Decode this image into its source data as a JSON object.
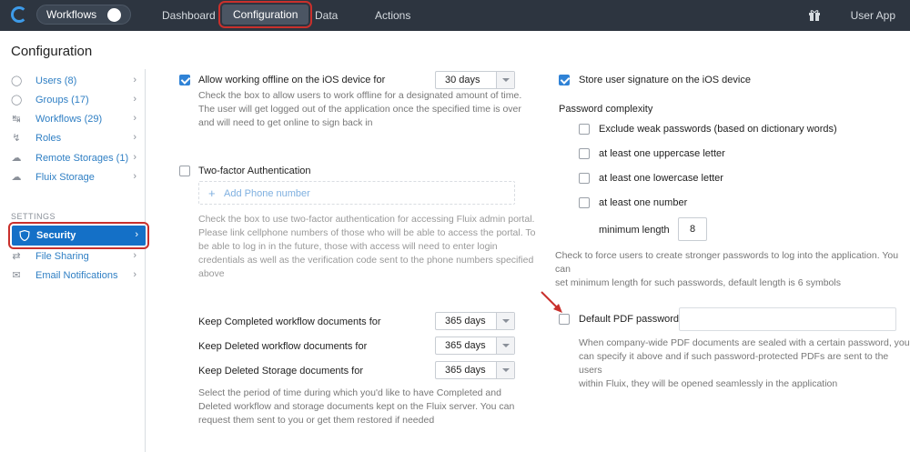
{
  "topbar": {
    "workflows_toggle_label": "Workflows",
    "nav": [
      "Dashboard",
      "Configuration",
      "Data",
      "Actions"
    ],
    "user": "User App"
  },
  "page_title": "Configuration",
  "sidebar": {
    "items": [
      {
        "label": "Users",
        "count": "(8)",
        "icon": "user-icon"
      },
      {
        "label": "Groups",
        "count": "(17)",
        "icon": "group-icon"
      },
      {
        "label": "Workflows",
        "count": "(29)",
        "icon": "workflow-icon"
      },
      {
        "label": "Roles",
        "count": "",
        "icon": "lightning-icon"
      },
      {
        "label": "Remote Storages",
        "count": "(1)",
        "icon": "cloud-icon"
      },
      {
        "label": "Fluix Storage",
        "count": "",
        "icon": "cloud-icon"
      }
    ],
    "settings_label": "SETTINGS",
    "settings_items": [
      {
        "label": "Security",
        "icon": "shield-icon"
      },
      {
        "label": "File Sharing",
        "icon": "share-icon"
      },
      {
        "label": "Email Notifications",
        "icon": "mail-icon"
      }
    ]
  },
  "left": {
    "offline_label": "Allow working offline on the iOS device for",
    "offline_value": "30 days",
    "offline_desc": [
      "Check the box to allow users to work offline for a designated amount of time.",
      "The user will get logged out of the application once the specified time is over",
      "and will need to get online to sign back in"
    ],
    "twofa_label": "Two-factor Authentication",
    "add_phone": "Add Phone number",
    "twofa_desc": [
      "Check the box to use two-factor authentication for accessing Fluix admin portal.",
      "Please link cellphone numbers of those who will be able to access the portal. To",
      "be able to log in in the future, those with access will need to enter login",
      "credentials as well as the verification code sent to the phone numbers specified",
      "above"
    ],
    "keep_completed": "Keep Completed workflow documents for",
    "keep_completed_value": "365 days",
    "keep_deleted": "Keep Deleted workflow documents for",
    "keep_deleted_value": "365 days",
    "keep_storage": "Keep Deleted Storage documents for",
    "keep_storage_value": "365 days",
    "keep_desc": [
      "Select the period of time during which you'd like to have Completed and",
      "Deleted workflow and storage documents kept on the Fluix server. You can",
      "request them sent to you or get them restored if needed"
    ]
  },
  "right": {
    "signature_label": "Store user signature on the iOS device",
    "password_complexity": "Password complexity",
    "exclude_weak": "Exclude weak passwords (based on dictionary words)",
    "uppercase": "at least one uppercase letter",
    "lowercase": "at least one lowercase letter",
    "number": "at least one number",
    "min_length_label": "minimum length",
    "min_length_value": "8",
    "complexity_desc": [
      "Check to force users to create stronger passwords to log into the application. You can",
      "set minimum length for such passwords, default length is 6 symbols"
    ],
    "pdf_label": "Default PDF password",
    "pdf_desc": [
      "When company-wide PDF documents are sealed with a certain password, you",
      "can specify it above and if such password-protected PDFs are sent to the users",
      "within Fluix, they will be opened seamlessly in the application"
    ]
  }
}
